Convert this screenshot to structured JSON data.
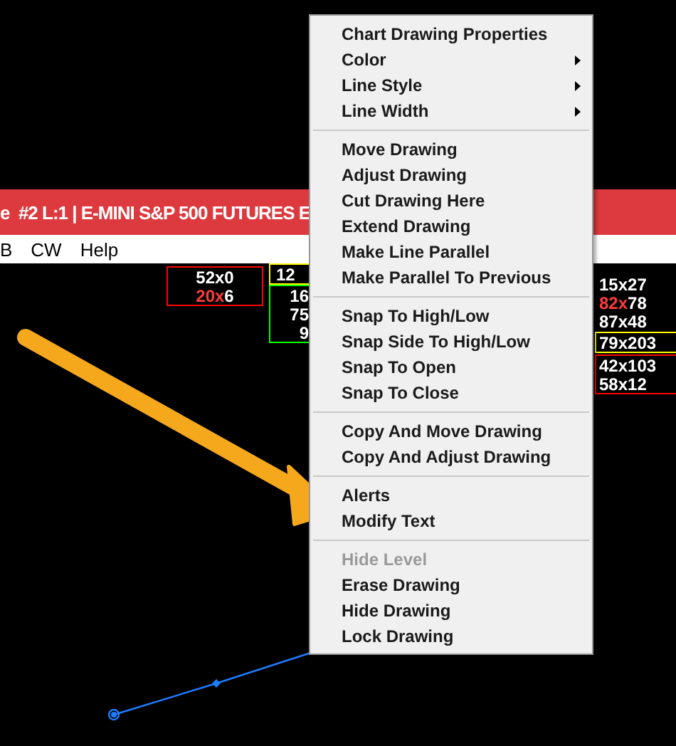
{
  "title_bar": {
    "text": "e  #2 L:1 | E-MINI S&P 500 FUTURES E"
  },
  "menu_bar": {
    "items": [
      "B",
      "CW",
      "Help"
    ]
  },
  "quote_boxes": [
    {
      "color": "#ff0000",
      "rows": [
        [
          {
            "text": "52x0",
            "color": "#ffffff"
          }
        ],
        [
          {
            "text": "20x",
            "color": "#ff3b3b"
          },
          {
            "text": "6",
            "color": "#ffffff"
          }
        ]
      ]
    },
    {
      "color": "#ffff00",
      "rows": [
        [
          {
            "text": "12"
          }
        ]
      ]
    },
    {
      "color": "#00ff00",
      "rows": [
        [
          {
            "text": "16"
          }
        ],
        [
          {
            "text": "75"
          }
        ],
        [
          {
            "text": "9"
          }
        ]
      ]
    },
    {
      "color": "#000000",
      "rows": [
        [
          {
            "text": "15x27",
            "color": "#ffffff"
          }
        ],
        [
          {
            "text": "82x",
            "color": "#ff3b3b"
          },
          {
            "text": "78",
            "color": "#ffffff"
          }
        ],
        [
          {
            "text": "87x48",
            "color": "#ffffff"
          }
        ]
      ]
    },
    {
      "color": "#ffff00",
      "rows": [
        [
          {
            "text": "79x203",
            "color": "#ffffff"
          }
        ]
      ]
    },
    {
      "color": "#ff0000",
      "rows": [
        [
          {
            "text": "42x103",
            "color": "#ffffff"
          }
        ],
        [
          {
            "text": "58x12",
            "color": "#ffffff"
          }
        ]
      ]
    }
  ],
  "context_menu": {
    "groups": [
      [
        {
          "label": "Chart Drawing Properties",
          "submenu": false,
          "disabled": false
        },
        {
          "label": "Color",
          "submenu": true,
          "disabled": false
        },
        {
          "label": "Line Style",
          "submenu": true,
          "disabled": false
        },
        {
          "label": "Line Width",
          "submenu": true,
          "disabled": false
        }
      ],
      [
        {
          "label": "Move Drawing",
          "submenu": false,
          "disabled": false
        },
        {
          "label": "Adjust Drawing",
          "submenu": false,
          "disabled": false
        },
        {
          "label": "Cut Drawing Here",
          "submenu": false,
          "disabled": false
        },
        {
          "label": "Extend Drawing",
          "submenu": false,
          "disabled": false
        },
        {
          "label": "Make Line Parallel",
          "submenu": false,
          "disabled": false
        },
        {
          "label": "Make Parallel To Previous",
          "submenu": false,
          "disabled": false
        }
      ],
      [
        {
          "label": "Snap To High/Low",
          "submenu": false,
          "disabled": false
        },
        {
          "label": "Snap Side To High/Low",
          "submenu": false,
          "disabled": false
        },
        {
          "label": "Snap To Open",
          "submenu": false,
          "disabled": false
        },
        {
          "label": "Snap To Close",
          "submenu": false,
          "disabled": false
        }
      ],
      [
        {
          "label": "Copy And Move Drawing",
          "submenu": false,
          "disabled": false
        },
        {
          "label": "Copy And Adjust Drawing",
          "submenu": false,
          "disabled": false
        }
      ],
      [
        {
          "label": "Alerts",
          "submenu": false,
          "disabled": false
        },
        {
          "label": "Modify Text",
          "submenu": false,
          "disabled": false
        }
      ],
      [
        {
          "label": "Hide Level",
          "submenu": false,
          "disabled": true
        },
        {
          "label": "Erase Drawing",
          "submenu": false,
          "disabled": false
        },
        {
          "label": "Hide Drawing",
          "submenu": false,
          "disabled": false
        },
        {
          "label": "Lock Drawing",
          "submenu": false,
          "disabled": false
        }
      ]
    ]
  }
}
